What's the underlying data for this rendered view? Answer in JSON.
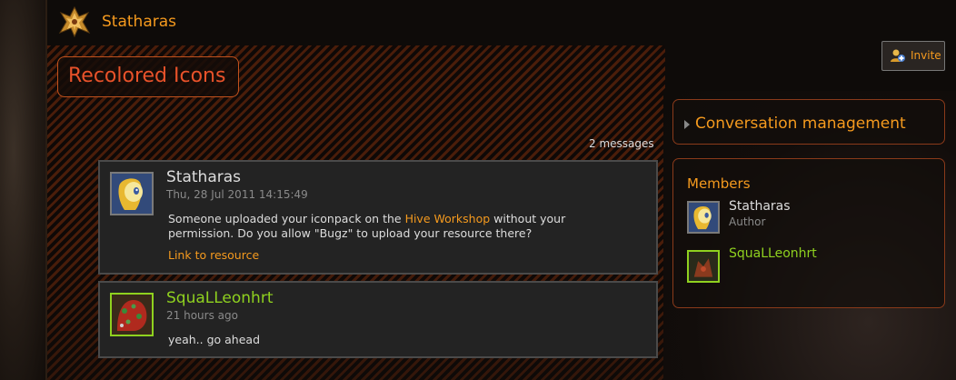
{
  "owner": {
    "name": "Statharas"
  },
  "conversation": {
    "title": "Recolored Icons",
    "message_count": "2 messages"
  },
  "invite": {
    "label": "Invite"
  },
  "messages": [
    {
      "author": "Statharas",
      "date": "Thu, 28 Jul 2011 14:15:49",
      "body_before": "Someone uploaded your iconpack on the ",
      "body_link": "Hive Workshop",
      "body_after": " without your permission. Do you allow \"Bugz\" to upload your resource there?",
      "resource_link": "Link to resource"
    },
    {
      "author": "SquaLLeonhrt",
      "date": "21 hours ago",
      "body": "yeah.. go ahead"
    }
  ],
  "sidebar": {
    "management_label": "Conversation management",
    "members_heading": "Members",
    "members": [
      {
        "name": "Statharas",
        "role": "Author"
      },
      {
        "name": "SquaLLeonhrt",
        "role": ""
      }
    ]
  },
  "colors": {
    "accent": "#f59a1e",
    "title": "#e8522a",
    "green_user": "#8fd11f",
    "panel_border": "#8a3a1a"
  },
  "icons": {
    "owner_logo": "protoss-emblem-icon",
    "invite": "users-add-icon",
    "expand_arrow": "triangle-right-icon"
  }
}
